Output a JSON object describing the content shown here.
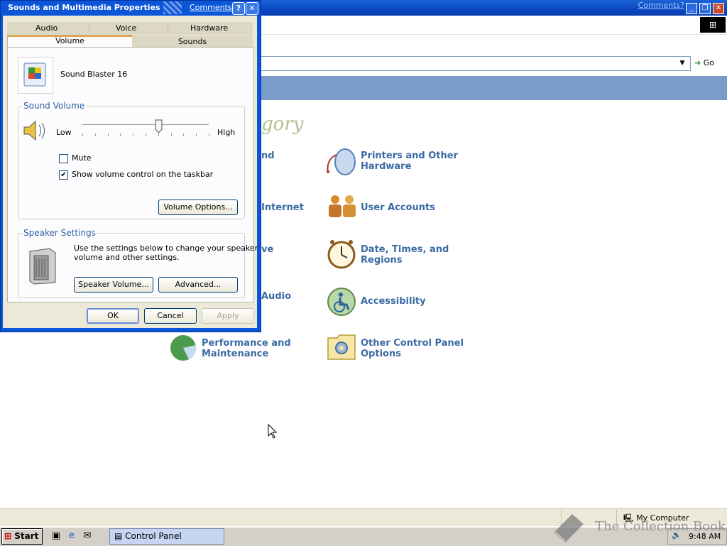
{
  "control_panel": {
    "comments_link": "Comments?",
    "window_buttons": [
      "_",
      "❐",
      "✕"
    ],
    "go_label": "Go",
    "category_heading_fragment": "gory",
    "categories": [
      {
        "label_line1": "nd",
        "label_line2": ""
      },
      {
        "label_line1": "Printers and Other",
        "label_line2": "Hardware"
      },
      {
        "label_line1": "Internet",
        "label_line2": ""
      },
      {
        "label_line1": "User Accounts",
        "label_line2": ""
      },
      {
        "label_line1": "ve",
        "label_line2": ""
      },
      {
        "label_line1": "Date, Times, and",
        "label_line2": "Regions"
      },
      {
        "label_line1": "Audio",
        "label_line2": ""
      },
      {
        "label_line1": "Accessibility",
        "label_line2": ""
      },
      {
        "label_line1": "Performance and",
        "label_line2": "Maintenance"
      },
      {
        "label_line1": "Other Control Panel",
        "label_line2": "Options"
      }
    ],
    "status_bar": {
      "location": "My Computer"
    }
  },
  "dialog": {
    "title": "Sounds and Multimedia Properties",
    "comments_link": "Comments?",
    "help_button": "?",
    "close_button": "✕",
    "tabs_row1": [
      "Audio",
      "Voice",
      "Hardware"
    ],
    "tabs_row2": [
      "Volume",
      "Sounds"
    ],
    "active_tab": "Volume",
    "device_name": "Sound Blaster 16",
    "sound_volume": {
      "title": "Sound Volume",
      "low_label": "Low",
      "high_label": "High",
      "level": 0.6,
      "mute_label": "Mute",
      "mute_checked": false,
      "show_in_taskbar_label": "Show volume control on the taskbar",
      "show_in_taskbar_checked": true,
      "volume_options_button": "Volume Options..."
    },
    "speaker_settings": {
      "title": "Speaker Settings",
      "description_line1": "Use the settings below to change your speaker",
      "description_line2": "volume and other settings.",
      "speaker_volume_button": "Speaker Volume...",
      "advanced_button": "Advanced..."
    },
    "ok_button": "OK",
    "cancel_button": "Cancel",
    "apply_button": "Apply"
  },
  "taskbar": {
    "start_label": "Start",
    "task_control_panel": "Control Panel",
    "clock": "9:48 AM"
  },
  "watermark": "The Collection Book",
  "colors": {
    "title_blue": "#0b55d9",
    "link_blue": "#3a6aa4",
    "group_title": "#2e5fa5",
    "dialog_face": "#ece9d8"
  }
}
